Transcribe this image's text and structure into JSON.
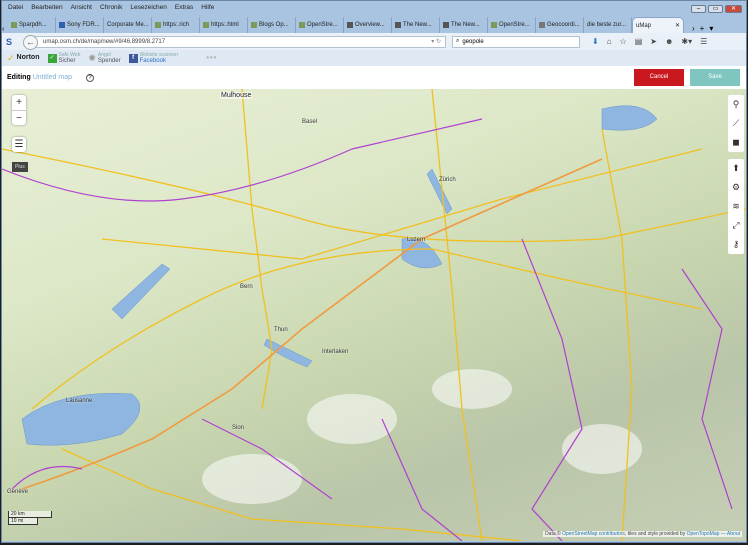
{
  "menu": [
    "Datei",
    "Bearbeiten",
    "Ansicht",
    "Chronik",
    "Lesezeichen",
    "Extras",
    "Hilfe"
  ],
  "tabs": [
    "Sparpdh...",
    "Sony FDR...",
    "Corporate Me...",
    "https:.rich",
    "https:.html",
    "Blogs Op...",
    "OpenStre...",
    "Overview...",
    "The New...",
    "The New...",
    "OpenStre...",
    "Geocoordi...",
    "die beste zur..."
  ],
  "active_tab": "uMap",
  "address": "umap.osm.ch/de/map/new/#9/46.8999/8.2717",
  "search": "geopole",
  "norton": {
    "brand": "Norton",
    "safe_web_top": "Safe Web",
    "safe_web": "Sicher",
    "identity_top": "Angel",
    "identity": "Spender",
    "facebook_top": "Website scannen",
    "facebook": "Facebook"
  },
  "editbar": {
    "editing": "Editing",
    "title": "Untitled map",
    "help": "?",
    "cancel": "Cancel",
    "save": "Save"
  },
  "map": {
    "zoom_in": "+",
    "zoom_out": "−",
    "tooltip": "Plus",
    "scale_km": "20 km",
    "scale_mi": "10 mi",
    "attribution_prefix": "Data ©",
    "attribution_link": "OpenStreetMap contributors",
    "attribution_mid": ", tiles and style provided by",
    "attribution_link2": "OpenTopoMap",
    "attribution_more": "— About",
    "places": [
      "Mulhouse",
      "Zürich",
      "Luzern",
      "Bern",
      "Thun",
      "Lausanne",
      "Genève",
      "Sion",
      "Interlaken",
      "Basel"
    ]
  }
}
